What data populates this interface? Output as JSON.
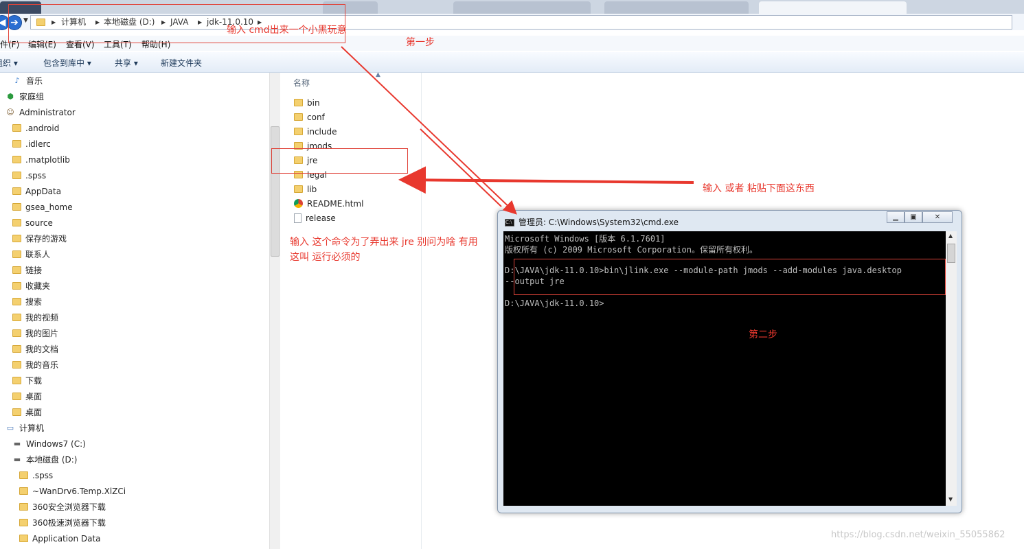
{
  "address_bar": {
    "crumbs": [
      "计算机",
      "本地磁盘 (D:)",
      "JAVA",
      "jdk-11.0.10"
    ]
  },
  "menu": [
    "件(F)",
    "编辑(E)",
    "查看(V)",
    "工具(T)",
    "帮助(H)"
  ],
  "toolbar": {
    "organize": "组织 ▾",
    "include_in_library": "包含到库中 ▾",
    "share": "共享 ▾",
    "new_folder": "新建文件夹"
  },
  "nav_items": [
    {
      "label": "音乐",
      "icon": "music-icon"
    },
    {
      "label": "家庭组",
      "icon": "homegroup-icon"
    },
    {
      "label": "Administrator",
      "icon": "user-icon"
    },
    {
      "label": ".android",
      "icon": "folder-icon"
    },
    {
      "label": ".idlerc",
      "icon": "folder-icon"
    },
    {
      "label": ".matplotlib",
      "icon": "folder-icon"
    },
    {
      "label": ".spss",
      "icon": "folder-icon"
    },
    {
      "label": "AppData",
      "icon": "folder-icon"
    },
    {
      "label": "gsea_home",
      "icon": "folder-icon"
    },
    {
      "label": "source",
      "icon": "folder-icon"
    },
    {
      "label": "保存的游戏",
      "icon": "folder-icon"
    },
    {
      "label": "联系人",
      "icon": "folder-icon"
    },
    {
      "label": "链接",
      "icon": "folder-icon"
    },
    {
      "label": "收藏夹",
      "icon": "folder-icon"
    },
    {
      "label": "搜索",
      "icon": "folder-icon"
    },
    {
      "label": "我的视频",
      "icon": "folder-icon"
    },
    {
      "label": "我的图片",
      "icon": "folder-icon"
    },
    {
      "label": "我的文档",
      "icon": "folder-icon"
    },
    {
      "label": "我的音乐",
      "icon": "folder-icon"
    },
    {
      "label": "下载",
      "icon": "folder-icon"
    },
    {
      "label": "桌面",
      "icon": "folder-icon"
    },
    {
      "label": "桌面",
      "icon": "folder-icon"
    },
    {
      "label": "计算机",
      "icon": "computer-icon"
    },
    {
      "label": "Windows7 (C:)",
      "icon": "drive-icon"
    },
    {
      "label": "本地磁盘 (D:)",
      "icon": "drive-icon"
    },
    {
      "label": ".spss",
      "icon": "folder-icon"
    },
    {
      "label": "~WanDrv6.Temp.XlZCi",
      "icon": "folder-icon"
    },
    {
      "label": "360安全浏览器下载",
      "icon": "folder-icon"
    },
    {
      "label": "360极速浏览器下载",
      "icon": "folder-icon"
    },
    {
      "label": "Application Data",
      "icon": "folder-icon"
    }
  ],
  "file_list": {
    "column_name": "名称",
    "items": [
      {
        "label": "bin",
        "icon": "folder-icon"
      },
      {
        "label": "conf",
        "icon": "folder-icon"
      },
      {
        "label": "include",
        "icon": "folder-icon"
      },
      {
        "label": "jmods",
        "icon": "folder-icon"
      },
      {
        "label": "jre",
        "icon": "folder-icon"
      },
      {
        "label": "legal",
        "icon": "folder-icon"
      },
      {
        "label": "lib",
        "icon": "folder-icon"
      },
      {
        "label": "README.html",
        "icon": "chrome-icon"
      },
      {
        "label": "release",
        "icon": "file-icon"
      }
    ]
  },
  "cmd": {
    "title": "管理员: C:\\Windows\\System32\\cmd.exe",
    "lines": [
      "Microsoft Windows [版本 6.1.7601]",
      "版权所有 (c) 2009 Microsoft Corporation。保留所有权利。",
      "",
      "D:\\JAVA\\jdk-11.0.10>bin\\jlink.exe --module-path jmods --add-modules java.desktop",
      " --output jre",
      "",
      "D:\\JAVA\\jdk-11.0.10>"
    ]
  },
  "annotations": {
    "step1_note": "输入 cmd出来一个小黑玩意",
    "step1": "第一步",
    "paste_note": "输入  或者 粘贴下面这东西",
    "jre_note_line1": "输入 这个命令为了弄出来 jre 别问为啥  有用",
    "jre_note_line2": "这叫 运行必须的",
    "step2": "第二步"
  },
  "watermark": "https://blog.csdn.net/weixin_55055862",
  "colors": {
    "annotation_red": "#e8382e",
    "folder_yellow": "#f4d06f"
  }
}
